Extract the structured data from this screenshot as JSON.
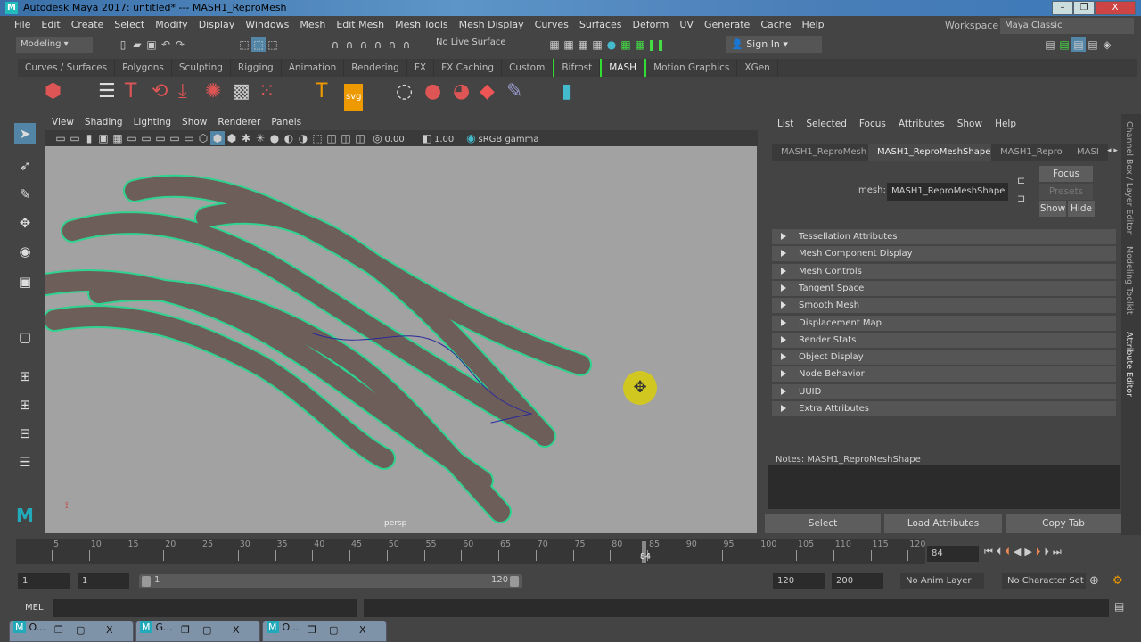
{
  "title": "Autodesk Maya 2017: untitled*   ---   MASH1_ReproMesh",
  "menus": [
    "File",
    "Edit",
    "Create",
    "Select",
    "Modify",
    "Display",
    "Windows",
    "Mesh",
    "Edit Mesh",
    "Mesh Tools",
    "Mesh Display",
    "Curves",
    "Surfaces",
    "Deform",
    "UV",
    "Generate",
    "Cache",
    "Help"
  ],
  "workspace": {
    "label": "Workspace :",
    "value": "Maya Classic"
  },
  "status": {
    "menuset": "Modeling",
    "live_surface": "No Live Surface",
    "sign_in": "Sign In"
  },
  "shelf_tabs": [
    "Curves / Surfaces",
    "Polygons",
    "Sculpting",
    "Rigging",
    "Animation",
    "Rendering",
    "FX",
    "FX Caching",
    "Custom",
    "Bifrost",
    "MASH",
    "Motion Graphics",
    "XGen"
  ],
  "viewport": {
    "menus": [
      "View",
      "Shading",
      "Lighting",
      "Show",
      "Renderer",
      "Panels"
    ],
    "exposure": "0.00",
    "gamma": "1.00",
    "colorspace": "sRGB gamma",
    "camera": "persp"
  },
  "ae": {
    "menus": [
      "List",
      "Selected",
      "Focus",
      "Attributes",
      "Show",
      "Help"
    ],
    "tabs": [
      "MASH1_ReproMesh",
      "MASH1_ReproMeshShape",
      "MASH1_Repro",
      "MASI"
    ],
    "mesh_label": "mesh:",
    "mesh_value": "MASH1_ReproMeshShape",
    "focus": "Focus",
    "presets": "Presets",
    "show": "Show",
    "hide": "Hide",
    "sections": [
      "Tessellation Attributes",
      "Mesh Component Display",
      "Mesh Controls",
      "Tangent Space",
      "Smooth Mesh",
      "Displacement Map",
      "Render Stats",
      "Object Display",
      "Node Behavior",
      "UUID",
      "Extra Attributes"
    ],
    "notes": "Notes:  MASH1_ReproMeshShape",
    "buttons": [
      "Select",
      "Load Attributes",
      "Copy Tab"
    ]
  },
  "side_tabs": [
    "Channel Box / Layer Editor",
    "Modeling Toolkit",
    "Attribute Editor"
  ],
  "timeline": {
    "ticks": [
      "5",
      "10",
      "15",
      "20",
      "25",
      "30",
      "35",
      "40",
      "45",
      "50",
      "55",
      "60",
      "65",
      "70",
      "75",
      "80",
      "85",
      "90",
      "95",
      "100",
      "105",
      "110",
      "115",
      "120"
    ],
    "current": "84",
    "current_field": "84"
  },
  "range": {
    "start": "1",
    "anim_start": "1",
    "slider_start": "1",
    "slider_end": "120",
    "end": "120",
    "anim_end": "200",
    "anim_layer": "No Anim Layer",
    "char_set": "No Character Set"
  },
  "cmdline": {
    "label": "MEL"
  },
  "taskbar": [
    {
      "label": "O..."
    },
    {
      "label": "G..."
    },
    {
      "label": "O..."
    }
  ]
}
